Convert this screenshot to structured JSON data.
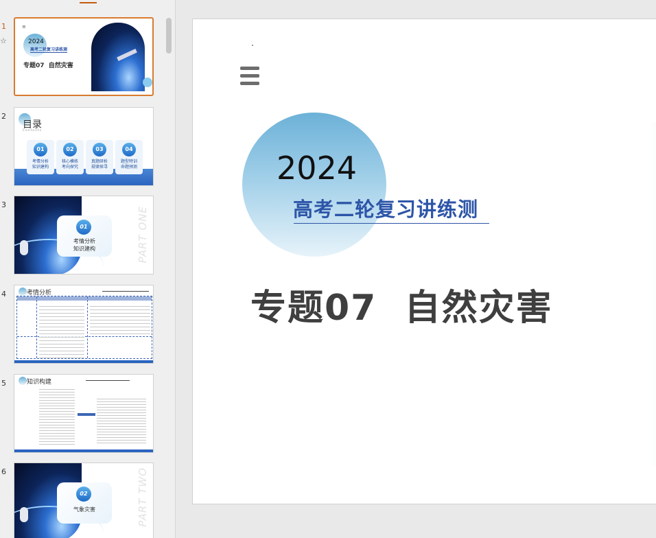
{
  "thumbnails": [
    {
      "num": "1",
      "menu_glyph": "≡",
      "year": "2024",
      "subtitle": "高考二轮复习讲练测",
      "title": "专题07  自然灾害"
    },
    {
      "num": "2",
      "heading": "目录",
      "heading_en": "C o n t e n t s",
      "items": [
        {
          "n": "01",
          "line1": "考情分析",
          "line2": "知识建构"
        },
        {
          "n": "02",
          "line1": "核心模练",
          "line2": "考向探究"
        },
        {
          "n": "03",
          "line1": "真题研析",
          "line2": "规律探寻"
        },
        {
          "n": "04",
          "line1": "题型特训",
          "line2": "命题预测"
        }
      ]
    },
    {
      "num": "3",
      "circle": "01",
      "line1": "考情分析",
      "line2": "知识建构",
      "side": "PART ONE"
    },
    {
      "num": "4",
      "heading": "考情分析"
    },
    {
      "num": "5",
      "heading": "知识构建"
    },
    {
      "num": "6",
      "circle": "02",
      "line1": "气象灾害",
      "side": "PART TWO"
    }
  ],
  "slide": {
    "year": "2024",
    "subtitle": "高考二轮复习讲练测",
    "title": "专题07  自然灾害"
  }
}
